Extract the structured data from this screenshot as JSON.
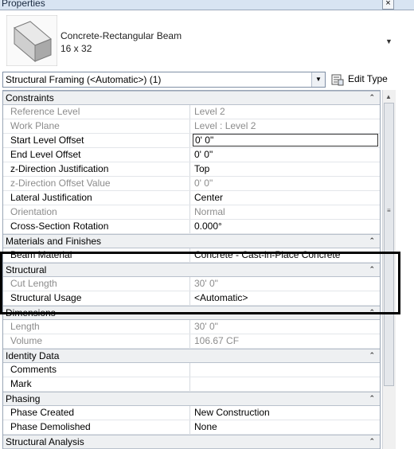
{
  "window": {
    "title": "Properties",
    "close_glyph": "×"
  },
  "type_header": {
    "name_line1": "Concrete-Rectangular Beam",
    "name_line2": "16 x 32",
    "thumbnail_icon": "beam-thumbnail-icon"
  },
  "selector": {
    "value": "Structural Framing (<Automatic>) (1)"
  },
  "edit_type": {
    "label": "Edit Type",
    "icon": "edit-type-icon"
  },
  "groups": {
    "constraints": {
      "label": "Constraints",
      "rows": [
        {
          "name": "Reference Level",
          "value": "Level 2"
        },
        {
          "name": "Work Plane",
          "value": "Level : Level 2"
        },
        {
          "name": "Start Level Offset",
          "value": "0'  0\""
        },
        {
          "name": "End Level Offset",
          "value": "0'  0\""
        },
        {
          "name": "z-Direction Justification",
          "value": "Top"
        },
        {
          "name": "z-Direction Offset Value",
          "value": "0'  0\""
        },
        {
          "name": "Lateral Justification",
          "value": "Center"
        },
        {
          "name": "Orientation",
          "value": "Normal"
        },
        {
          "name": "Cross-Section Rotation",
          "value": "0.000°"
        }
      ]
    },
    "materials": {
      "label": "Materials and Finishes",
      "rows": [
        {
          "name": "Beam Material",
          "value": "Concrete - Cast-in-Place Concrete"
        }
      ]
    },
    "structural": {
      "label": "Structural",
      "rows": [
        {
          "name": "Cut Length",
          "value": "30'  0\""
        },
        {
          "name": "Structural Usage",
          "value": "<Automatic>"
        }
      ]
    },
    "dimensions": {
      "label": "Dimensions",
      "rows": [
        {
          "name": "Length",
          "value": "30'  0\""
        },
        {
          "name": "Volume",
          "value": "106.67 CF"
        }
      ]
    },
    "identity": {
      "label": "Identity Data",
      "rows": [
        {
          "name": "Comments",
          "value": ""
        },
        {
          "name": "Mark",
          "value": ""
        }
      ]
    },
    "phasing": {
      "label": "Phasing",
      "rows": [
        {
          "name": "Phase Created",
          "value": "New Construction"
        },
        {
          "name": "Phase Demolished",
          "value": "None"
        }
      ]
    },
    "analysis": {
      "label": "Structural Analysis"
    }
  },
  "colors": {
    "group_bg": "#eef0f2",
    "readonly_text": "#8c8c8c",
    "title_bg": "#d8e4f2"
  }
}
